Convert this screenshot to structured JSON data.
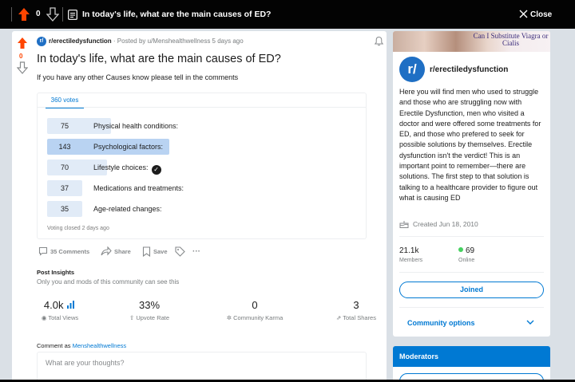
{
  "topbar": {
    "vote_count": "0",
    "title": "In today's life, what are the main causes of ED?",
    "close_label": "Close"
  },
  "post": {
    "vote_count": "0",
    "subreddit": "r/erectiledysfunction",
    "posted_by": "· Posted by u/Menshealthwellness 5 days ago",
    "title": "In today's life, what are the main causes of ED?",
    "body": "If you have any other Causes know please tell in the comments",
    "poll": {
      "votes_tab": "360 votes",
      "total": 360,
      "options": [
        {
          "count": "75",
          "label": "Physical health conditions:",
          "value": 75,
          "winner": false
        },
        {
          "count": "143",
          "label": "Psychological factors:",
          "value": 143,
          "winner": true
        },
        {
          "count": "70",
          "label": "Lifestyle choices:",
          "value": 70,
          "winner": false
        },
        {
          "count": "37",
          "label": "Medications and treatments:",
          "value": 37,
          "winner": false
        },
        {
          "count": "35",
          "label": "Age-related changes:",
          "value": 35,
          "winner": false
        }
      ],
      "footer": "Voting closed 2 days ago"
    },
    "actions": {
      "comments": "35 Comments",
      "share": "Share",
      "save": "Save",
      "more": "···"
    },
    "insights": {
      "heading": "Post Insights",
      "subtext": "Only you and mods of this community can see this",
      "stats": [
        {
          "value": "4.0k",
          "label": "Total Views"
        },
        {
          "value": "33%",
          "label": "Upvote Rate"
        },
        {
          "value": "0",
          "label": "Community Karma"
        },
        {
          "value": "3",
          "label": "Total Shares"
        }
      ]
    },
    "comment": {
      "as_label": "Comment as",
      "username": "Menshealthwellness",
      "placeholder": "What are your thoughts?"
    }
  },
  "sidebar": {
    "banner_text": "Can I Substitute Viagra or Cialis",
    "community_name": "r/erectiledysfunction",
    "description": "Here you will find men who used to struggle and those who are struggling now with Erectile Dysfunction, men who visited a doctor and were offered some treatments for ED, and those who prefered to seek for possible solutions by themselves. Erectile dysfunction isn't the verdict! This is an important point to remember—there are solutions. The first step to that solution is talking to a healthcare provider to figure out what is causing ED",
    "created": "Created Jun 18, 2010",
    "members_value": "21.1k",
    "members_label": "Members",
    "online_value": "69",
    "online_label": "Online",
    "joined_label": "Joined",
    "community_options": "Community options",
    "moderators_heading": "Moderators"
  },
  "colors": {
    "upvote": "#ff4500",
    "accent": "#0079d3",
    "poll_bar": "#e1ebf7",
    "poll_bar_winner": "#b9d3f2",
    "online": "#46d160"
  }
}
